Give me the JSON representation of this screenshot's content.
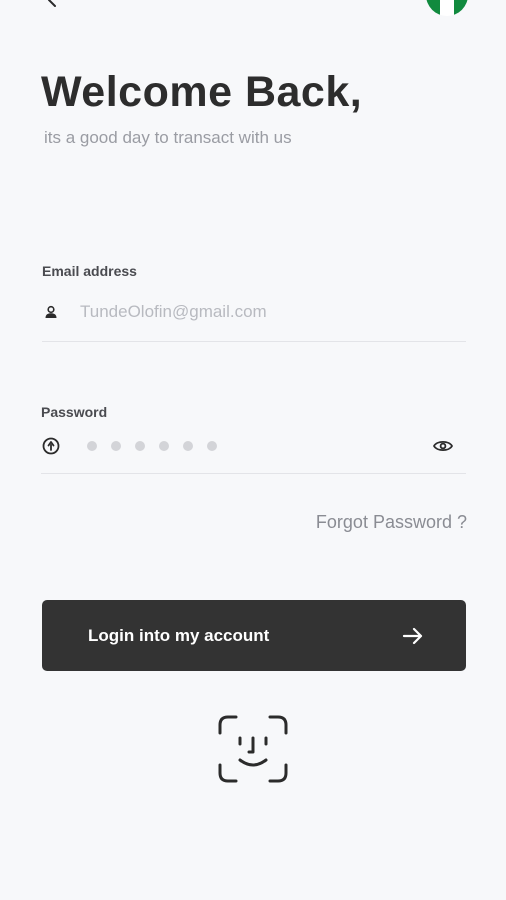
{
  "header": {
    "back_icon": "chevron-left-icon",
    "flag_icon": "nigeria-flag-icon",
    "flag_colors": [
      "#118a3e",
      "#ffffff",
      "#118a3e"
    ]
  },
  "welcome": {
    "title": "Welcome Back,",
    "subtitle": "its a good day to transact with us"
  },
  "email": {
    "label": "Email address",
    "placeholder": "TundeOlofin@gmail.com",
    "value": "",
    "icon": "user-icon"
  },
  "password": {
    "label": "Password",
    "masked_length": 6,
    "icon": "lock-icon",
    "toggle_icon": "eye-icon"
  },
  "forgot_password": "Forgot Password ?",
  "login_button": {
    "label": "Login into my account",
    "icon": "arrow-right-icon",
    "background": "#333333"
  },
  "biometric": {
    "icon": "face-id-icon"
  }
}
